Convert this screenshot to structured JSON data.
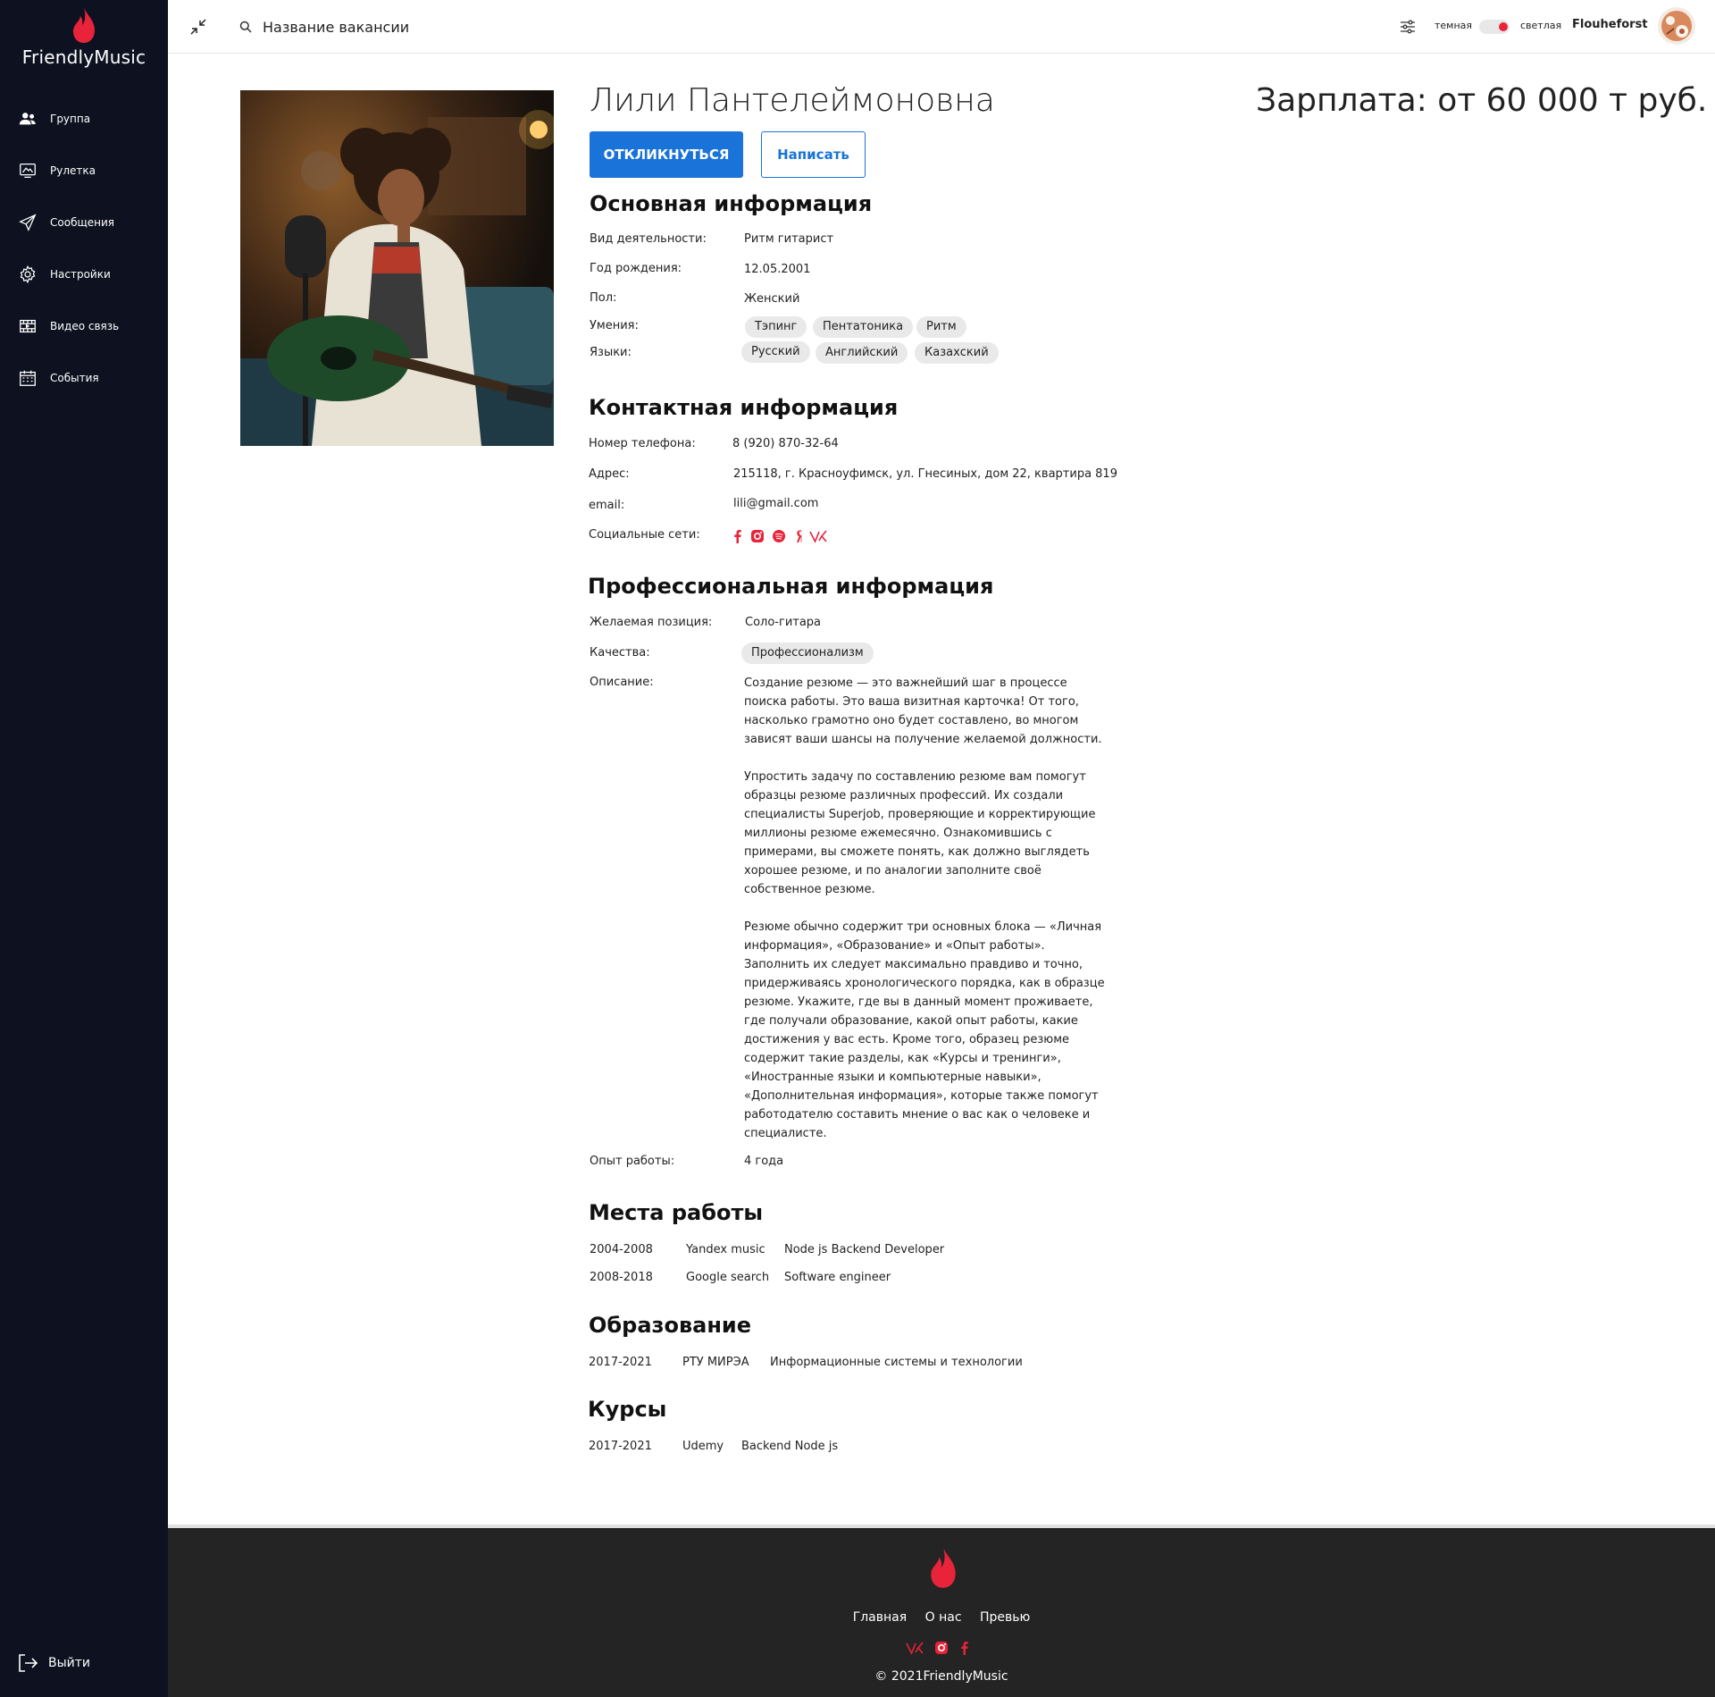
{
  "brand": {
    "name": "FriendlyMusic"
  },
  "nav": {
    "items": [
      {
        "label": "Группа",
        "icon": "users-icon"
      },
      {
        "label": "Рулетка",
        "icon": "roulette-icon"
      },
      {
        "label": "Сообщения",
        "icon": "send-icon"
      },
      {
        "label": "Настройки",
        "icon": "gear-icon"
      },
      {
        "label": "Видео связь",
        "icon": "video-icon"
      },
      {
        "label": "События",
        "icon": "calendar-icon"
      }
    ],
    "logout": "Выйти"
  },
  "header": {
    "search_placeholder": "Название вакансии",
    "theme_dark": "темная",
    "theme_light": "светлая",
    "username": "Flouheforst"
  },
  "profile": {
    "name": "Лили Пантелеймоновна",
    "salary": "Зарплата: от 60 000 т руб.",
    "respond_button": "ОТКЛИКНУТЬСЯ",
    "write_button": "Написать"
  },
  "basic": {
    "title": "Основная информация",
    "activity_label": "Вид деятельности:",
    "activity_value": "Ритм гитарист",
    "birth_label": "Год рождения:",
    "birth_value": "12.05.2001",
    "gender_label": "Пол:",
    "gender_value": "Женский",
    "skills_label": "Умения:",
    "skills": [
      "Тэпинг",
      "Пентатоника",
      "Ритм"
    ],
    "languages_label": "Языки:",
    "languages": [
      "Русский",
      "Английский",
      "Казахский"
    ]
  },
  "contact": {
    "title": "Контактная информация",
    "phone_label": "Номер телефона:",
    "phone_value": "8 (920) 870-32-64",
    "address_label": "Адрес:",
    "address_value": "215118, г. Красноуфимск, ул. Гнесиных, дом 22, квартира 819",
    "email_label": "email:",
    "email_value": "lili@gmail.com",
    "social_label": "Социальные сети:",
    "accent": "#e8233a"
  },
  "professional": {
    "title": "Профессиональная информация",
    "position_label": "Желаемая позиция:",
    "position_value": "Соло-гитара",
    "qualities_label": "Качества:",
    "qualities": [
      "Профессионализм"
    ],
    "description_label": "Описание:",
    "description": [
      "Создание резюме — это важнейший шаг в процессе поиска работы. Это ваша визитная карточка! От того, насколько грамотно оно будет составлено, во многом зависят ваши шансы на получение желаемой должности.",
      "Упростить задачу по составлению резюме вам помогут образцы резюме различных профессий. Их создали специалисты Superjob, проверяющие и корректирующие миллионы резюме ежемесячно. Ознакомившись с примерами, вы сможете понять, как должно выглядеть хорошее резюме, и по аналогии заполните своё собственное резюме.",
      "Резюме обычно содержит три основных блока — «Личная информация», «Образование» и «Опыт работы». Заполнить их следует максимально правдиво и точно, придерживаясь хронологического порядка, как в образце резюме. Укажите, где вы в данный момент проживаете, где получали образование, какой опыт работы, какие достижения у вас есть. Кроме того, образец резюме содержит такие разделы, как «Курсы и тренинги», «Иностранные языки и компьютерные навыки», «Дополнительная информация», которые также помогут работодателю составить мнение о вас как о человеке и специалисте."
    ],
    "experience_label": "Опыт работы:",
    "experience_value": "4 года"
  },
  "workplaces": {
    "title": "Места работы",
    "rows": [
      {
        "years": "2004-2008",
        "company": "Yandex music",
        "role": "Node js Backend Developer"
      },
      {
        "years": "2008-2018",
        "company": "Google search",
        "role": "Software engineer"
      }
    ]
  },
  "education": {
    "title": "Образование",
    "rows": [
      {
        "years": "2017-2021",
        "place": "РТУ МИРЭА",
        "field": "Информационные системы и технологии"
      }
    ]
  },
  "courses": {
    "title": "Курсы",
    "rows": [
      {
        "years": "2017-2021",
        "place": "Udemy",
        "field": "Backend Node js"
      }
    ]
  },
  "footer": {
    "links": [
      "Главная",
      "О нас",
      "Превью"
    ],
    "copyright": "© 2021FriendlyMusic"
  }
}
